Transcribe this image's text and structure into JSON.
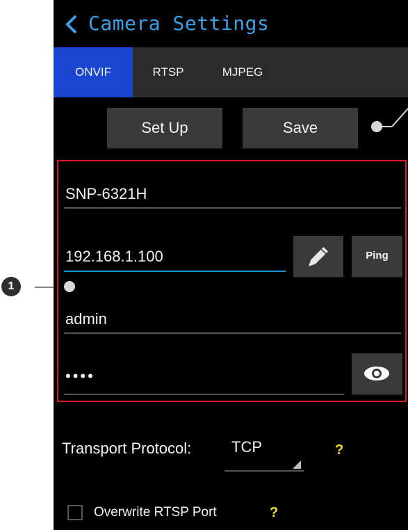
{
  "header": {
    "title": "Camera Settings",
    "back_icon": "chevron-left-icon"
  },
  "tabs": [
    {
      "label": "ONVIF",
      "active": true
    },
    {
      "label": "RTSP",
      "active": false
    },
    {
      "label": "MJPEG",
      "active": false
    }
  ],
  "actions": {
    "setup_label": "Set Up",
    "save_label": "Save"
  },
  "form": {
    "model": "SNP-6321H",
    "ip_address": "192.168.1.100",
    "username": "admin",
    "password_mask": "••••",
    "edit_icon": "pencil-icon",
    "ping_label": "Ping",
    "show_password_icon": "eye-icon"
  },
  "transport": {
    "label": "Transport Protocol:",
    "value": "TCP",
    "help": "?"
  },
  "overwrite": {
    "label": "Overwrite RTSP Port",
    "checked": false,
    "help": "?"
  },
  "callouts": {
    "form_marker": "1"
  },
  "colors": {
    "accent": "#1a45d0",
    "title": "#3aa0e8",
    "highlight_box": "#d21e2b",
    "help": "#f0e020"
  }
}
